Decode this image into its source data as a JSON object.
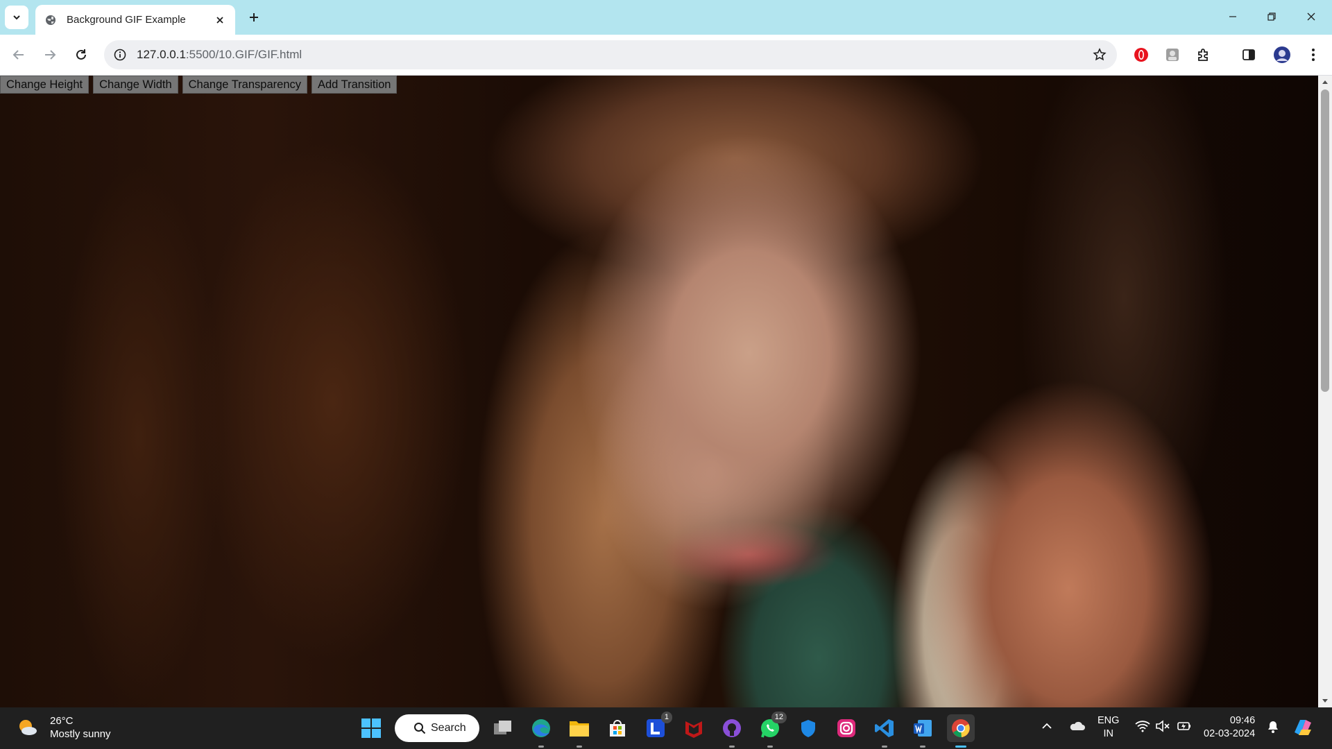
{
  "browser": {
    "tab_title": "Background GIF Example",
    "url_host": "127.0.0.1",
    "url_path": ":5500/10.GIF/GIF.html"
  },
  "page": {
    "buttons": [
      {
        "label": "Change Height"
      },
      {
        "label": "Change Width"
      },
      {
        "label": "Change Transparency"
      },
      {
        "label": "Add Transition"
      }
    ]
  },
  "taskbar": {
    "weather_temp": "26°C",
    "weather_desc": "Mostly sunny",
    "search_label": "Search",
    "badge_l": "1",
    "badge_whatsapp": "12",
    "lang_top": "ENG",
    "lang_bottom": "IN",
    "time": "09:46",
    "date": "02-03-2024"
  }
}
